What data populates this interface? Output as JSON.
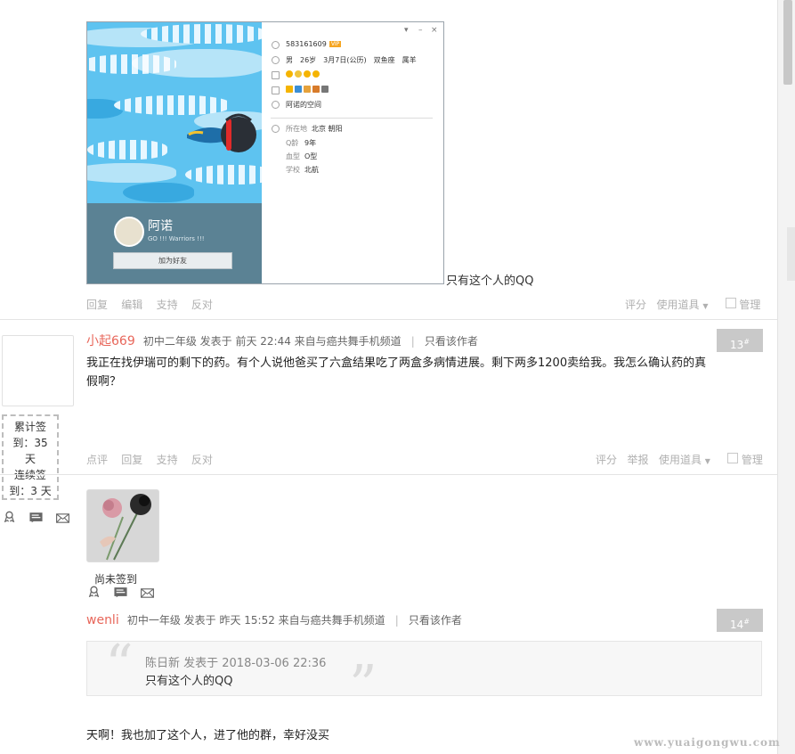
{
  "post12": {
    "qq_card": {
      "qq_number": "583161609",
      "vip_badge": "VIP",
      "profile_line": "男　26岁　3月7日(公历)　双鱼座　属羊",
      "space_link": "阿诺的空间",
      "location_label": "所在地",
      "location_value": "北京 朝阳",
      "qage_label": "Q龄",
      "qage_value": "9年",
      "blood_label": "血型",
      "blood_value": "O型",
      "school_label": "学校",
      "school_value": "北航",
      "nickname": "阿诺",
      "signature": "GO !!! Warriors !!!",
      "add_friend": "加为好友",
      "window_controls": [
        "▾",
        "–",
        "×"
      ]
    },
    "caption": "只有这个人的QQ",
    "actions_left": [
      "回复",
      "编辑",
      "支持",
      "反对"
    ],
    "actions_right": [
      "评分",
      "使用道具",
      "管理"
    ]
  },
  "post13": {
    "username": "小起669",
    "meta": "初中二年级 发表于 前天 22:44 来自与癌共舞手机频道",
    "only_author": "只看该作者",
    "floor": "13",
    "floor_sup": "#",
    "content_line1": "我正在找伊瑞可的剩下的药。有个人说他爸买了六盒结果吃了两盒多病情进展。剩下两多1200卖给我。我怎么确认药的真",
    "content_line2": "假啊？",
    "signin_lines": [
      "累计签",
      "到：35",
      "天",
      "连续签",
      "到：3 天"
    ],
    "actions_left": [
      "点评",
      "回复",
      "支持",
      "反对"
    ],
    "actions_right": [
      "评分",
      "举报",
      "使用道具",
      "管理"
    ]
  },
  "post14": {
    "not_signed": "尚未签到",
    "username": "wenli",
    "meta": "初中一年级 发表于 昨天 15:52 来自与癌共舞手机频道",
    "only_author": "只看该作者",
    "floor": "14",
    "floor_sup": "#",
    "quote_meta": "陈日新 发表于 2018-03-06 22:36",
    "quote_text": "只有这个人的QQ",
    "reply_text": "天啊！我也加了这个人，进了他的群，幸好没买"
  },
  "watermark": "www.yuaigongwu.com",
  "colors": {
    "username": "#e8665a",
    "floor_badge": "#c9c9c9",
    "muted": "#b0b0b0"
  },
  "icons": [
    "medal-icon",
    "profile-card-icon",
    "message-icon",
    "chevron-down-icon"
  ]
}
